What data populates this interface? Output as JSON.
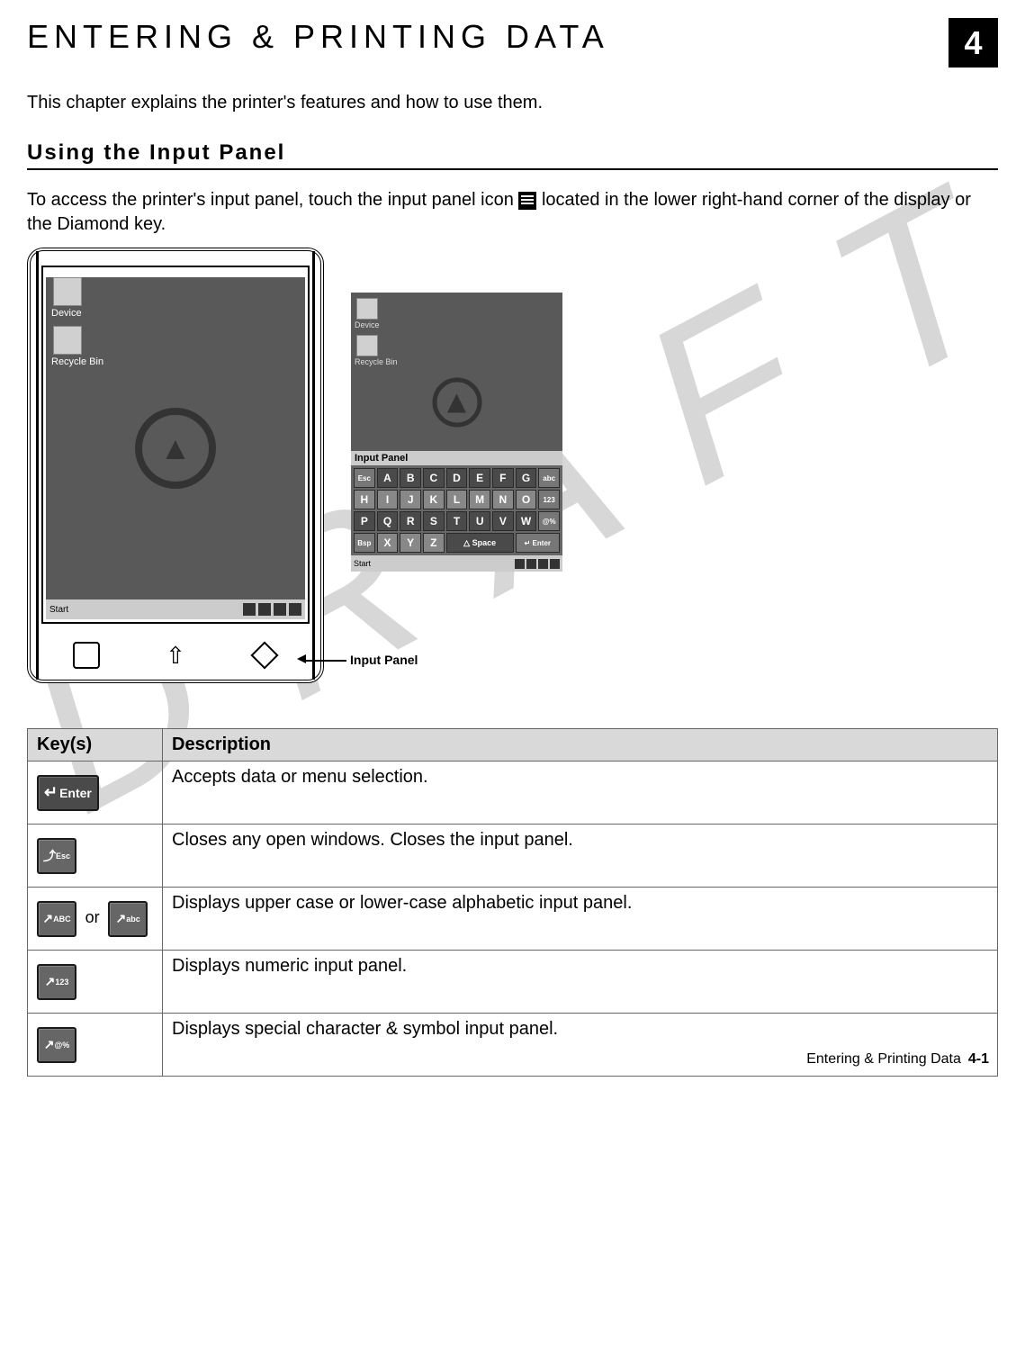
{
  "watermark": "D R A F T",
  "chapter": {
    "title": "ENTERING & PRINTING DATA",
    "number": "4"
  },
  "intro": "This chapter explains the printer's features and how to use them.",
  "section": {
    "title": "Using the Input Panel"
  },
  "paragraph_parts": {
    "p1a": "To access the printer's input panel, touch the input panel icon ",
    "p1b": " located in the lower right-hand corner of the display or the Diamond key."
  },
  "device": {
    "icon_labels": {
      "device": "Device",
      "recycle": "Recycle Bin"
    },
    "taskbar_start": "Start",
    "callout": "Input Panel"
  },
  "panel": {
    "title": "Input Panel",
    "rows": [
      [
        "Esc",
        "A",
        "B",
        "C",
        "D",
        "E",
        "F",
        "G",
        "abc"
      ],
      [
        "H",
        "I",
        "J",
        "K",
        "L",
        "M",
        "N",
        "O",
        "123"
      ],
      [
        "P",
        "Q",
        "R",
        "S",
        "T",
        "U",
        "V",
        "W",
        "@%"
      ],
      [
        "Bsp",
        "X",
        "Y",
        "Z",
        "△ Space",
        "↵ Enter"
      ]
    ],
    "taskbar_start": "Start"
  },
  "table": {
    "headers": [
      "Key(s)",
      "Description"
    ],
    "rows": [
      {
        "key_label": "↵ Enter",
        "key_type": "enter",
        "desc": "Accepts data or menu selection."
      },
      {
        "key_label": "Esc",
        "key_type": "esc",
        "desc": "Closes any open windows.  Closes the input panel."
      },
      {
        "key_label": "ABC",
        "key_label2": "abc",
        "joiner": "or",
        "key_type": "abc",
        "desc": "Displays upper case or lower-case alphabetic input panel."
      },
      {
        "key_label": "123",
        "key_type": "123",
        "desc": "Displays numeric input panel."
      },
      {
        "key_label": "@%",
        "key_type": "sym",
        "desc": "Displays special character & symbol input panel."
      }
    ]
  },
  "footer": {
    "text": "Entering & Printing Data",
    "page": "4-1"
  }
}
